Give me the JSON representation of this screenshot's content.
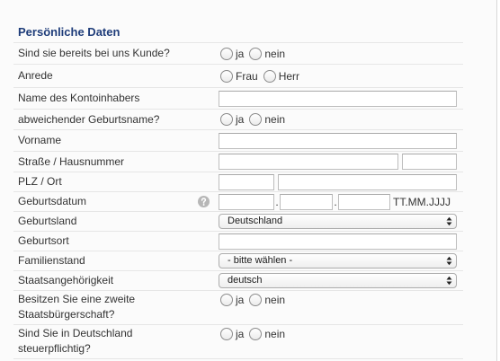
{
  "section": {
    "title": "Persönliche Daten"
  },
  "fields": {
    "existing_customer": {
      "label": "Sind sie bereits bei uns Kunde?",
      "options": [
        {
          "label": "ja",
          "checked": false
        },
        {
          "label": "nein",
          "checked": false
        }
      ]
    },
    "salutation": {
      "label": "Anrede",
      "options": [
        {
          "label": "Frau",
          "checked": false
        },
        {
          "label": "Herr",
          "checked": false
        }
      ]
    },
    "account_holder": {
      "label": "Name des Kontoinhabers",
      "value": ""
    },
    "different_birth_name": {
      "label": "abweichender Geburtsname?",
      "options": [
        {
          "label": "ja",
          "checked": false
        },
        {
          "label": "nein",
          "checked": false
        }
      ]
    },
    "first_name": {
      "label": "Vorname",
      "value": ""
    },
    "street": {
      "label": "Straße / Hausnummer",
      "street_value": "",
      "house_number_value": ""
    },
    "zip_city": {
      "label": "PLZ / Ort",
      "zip_value": "",
      "city_value": ""
    },
    "birth_date": {
      "label": "Geburtsdatum",
      "help_icon": "question-icon",
      "day_value": "",
      "month_value": "",
      "year_value": "",
      "separator": ".",
      "format_hint": "TT.MM.JJJJ"
    },
    "birth_country": {
      "label": "Geburtsland",
      "selected": "Deutschland"
    },
    "birth_place": {
      "label": "Geburtsort",
      "value": ""
    },
    "marital_status": {
      "label": "Familienstand",
      "selected": "- bitte wählen -"
    },
    "nationality": {
      "label": "Staatsangehörigkeit",
      "selected": "deutsch"
    },
    "second_citizenship": {
      "label": "Besitzen Sie eine zweite Staatsbürgerschaft?",
      "options": [
        {
          "label": "ja",
          "checked": false
        },
        {
          "label": "nein",
          "checked": false
        }
      ]
    },
    "tax_liable_germany": {
      "label": "Sind Sie in Deutschland steuerpflichtig?",
      "options": [
        {
          "label": "ja",
          "checked": false
        },
        {
          "label": "nein",
          "checked": false
        }
      ]
    }
  },
  "icons": {
    "select_arrows": "up-down-arrows-icon",
    "help": "question-icon"
  },
  "colors": {
    "title": "#1f3d7a",
    "label_text": "#333333",
    "divider": "#e6e6e6",
    "background": "#fbfbfb"
  }
}
